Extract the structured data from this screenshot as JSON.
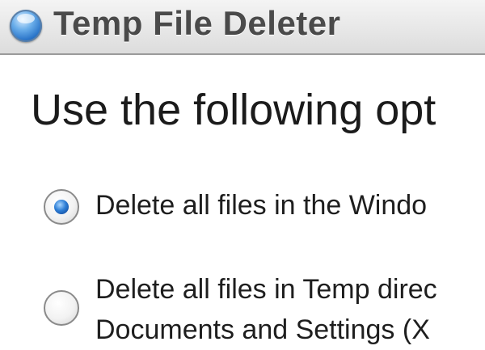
{
  "window": {
    "title": "Temp File Deleter",
    "icon": "blue-orb-icon"
  },
  "main": {
    "heading": "Use the following opt",
    "options": [
      {
        "label": "Delete all files in the Windo",
        "selected": true
      },
      {
        "label_line1": "Delete all files in Temp direc",
        "label_line2": "Documents and Settings (X",
        "selected": false
      }
    ]
  }
}
